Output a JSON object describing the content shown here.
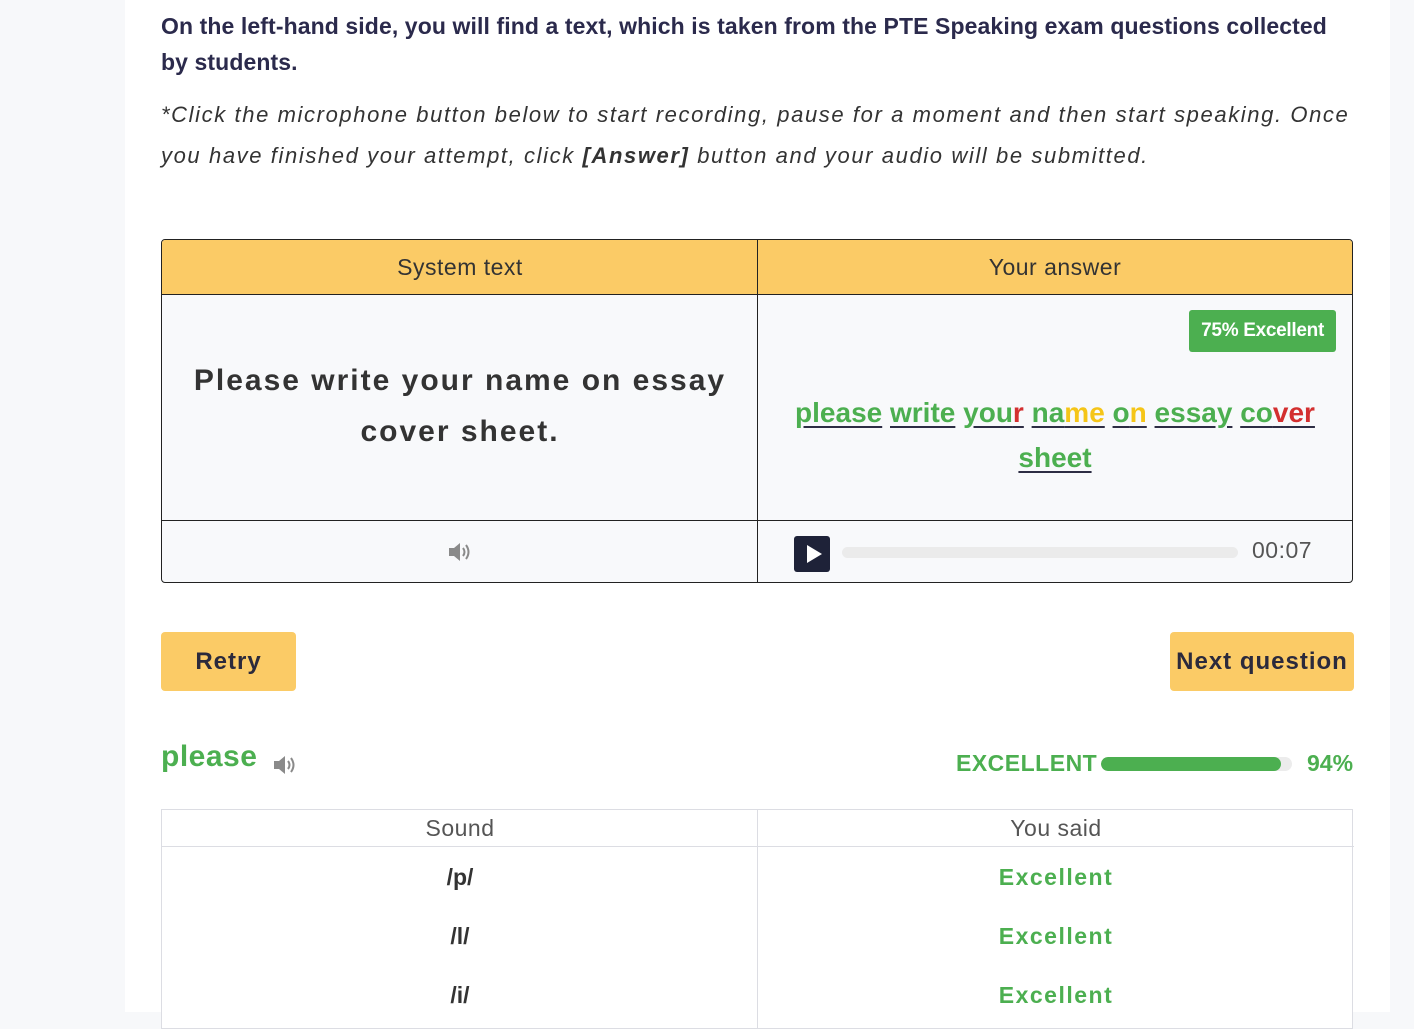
{
  "intro": {
    "title": "On the left-hand side, you will find a text, which is taken from the PTE Speaking exam questions collected by students.",
    "instruction_before": "*Click the microphone button below to start recording, pause for a moment and then start speaking. Once you have finished your attempt, click ",
    "instruction_bold": "[Answer]",
    "instruction_after": " button and your audio will be submitted."
  },
  "comparison": {
    "left_header": "System text",
    "right_header": "Your answer",
    "system_text": "Please write your name on essay cover sheet.",
    "score_badge": "75% Excellent",
    "answer_words": [
      {
        "parts": [
          {
            "t": "please",
            "c": "#4caf50"
          }
        ]
      },
      {
        "parts": [
          {
            "t": "write",
            "c": "#4caf50"
          }
        ]
      },
      {
        "parts": [
          {
            "t": "you",
            "c": "#4caf50"
          },
          {
            "t": "r",
            "c": "#d32f2f"
          }
        ]
      },
      {
        "parts": [
          {
            "t": "na",
            "c": "#4caf50"
          },
          {
            "t": "me",
            "c": "#f5c518"
          }
        ]
      },
      {
        "parts": [
          {
            "t": "o",
            "c": "#4caf50"
          },
          {
            "t": "n",
            "c": "#f5c518"
          }
        ]
      },
      {
        "parts": [
          {
            "t": "essay",
            "c": "#4caf50"
          }
        ]
      },
      {
        "parts": [
          {
            "t": "co",
            "c": "#4caf50"
          },
          {
            "t": "ver",
            "c": "#d32f2f"
          }
        ]
      },
      {
        "parts": [
          {
            "t": "sheet",
            "c": "#4caf50"
          }
        ]
      }
    ],
    "audio_time": "00:07"
  },
  "buttons": {
    "retry": "Retry",
    "next": "Next question"
  },
  "word_detail": {
    "word": "please",
    "rating": "EXCELLENT",
    "percent_label": "94%",
    "percent_value": 94,
    "sound_header": "Sound",
    "said_header": "You said",
    "sounds": [
      {
        "phoneme": "/p/",
        "result": "Excellent"
      },
      {
        "phoneme": "/l/",
        "result": "Excellent"
      },
      {
        "phoneme": "/i/",
        "result": "Excellent"
      }
    ]
  },
  "colors": {
    "accent_yellow": "#fbcb66",
    "good_green": "#4caf50",
    "bad_red": "#d32f2f",
    "mid_yellow": "#f5c518"
  }
}
